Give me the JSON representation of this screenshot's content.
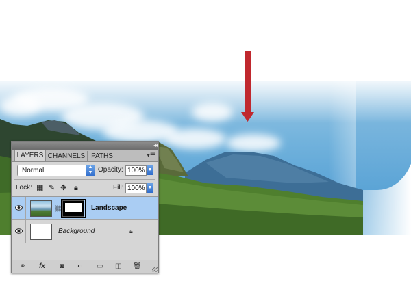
{
  "image": {
    "colors": {
      "sky": "#6cb0dc",
      "grass": "#4a7a2c",
      "arrow": "#c0282e"
    }
  },
  "layers_panel": {
    "tabs": [
      {
        "label": "LAYERS",
        "active": true
      },
      {
        "label": "CHANNELS",
        "active": false
      },
      {
        "label": "PATHS",
        "active": false
      }
    ],
    "blend_mode": "Normal",
    "opacity_label": "Opacity:",
    "opacity_value": "100%",
    "lock_label": "Lock:",
    "fill_label": "Fill:",
    "fill_value": "100%",
    "layers": [
      {
        "name": "Landscape",
        "visible": true,
        "selected": true,
        "has_mask": true,
        "locked": false
      },
      {
        "name": "Background",
        "visible": true,
        "selected": false,
        "has_mask": false,
        "locked": true
      }
    ],
    "footer_icons": [
      "link-layers-icon",
      "fx-icon",
      "add-mask-icon",
      "adjustment-layer-icon",
      "new-group-icon",
      "new-layer-icon",
      "trash-icon"
    ],
    "footer_labels": {
      "link": "⚭",
      "fx": "fx",
      "mask": "◙",
      "adjust": "◐",
      "group": "▭",
      "new": "◫",
      "trash": "🗑"
    }
  }
}
